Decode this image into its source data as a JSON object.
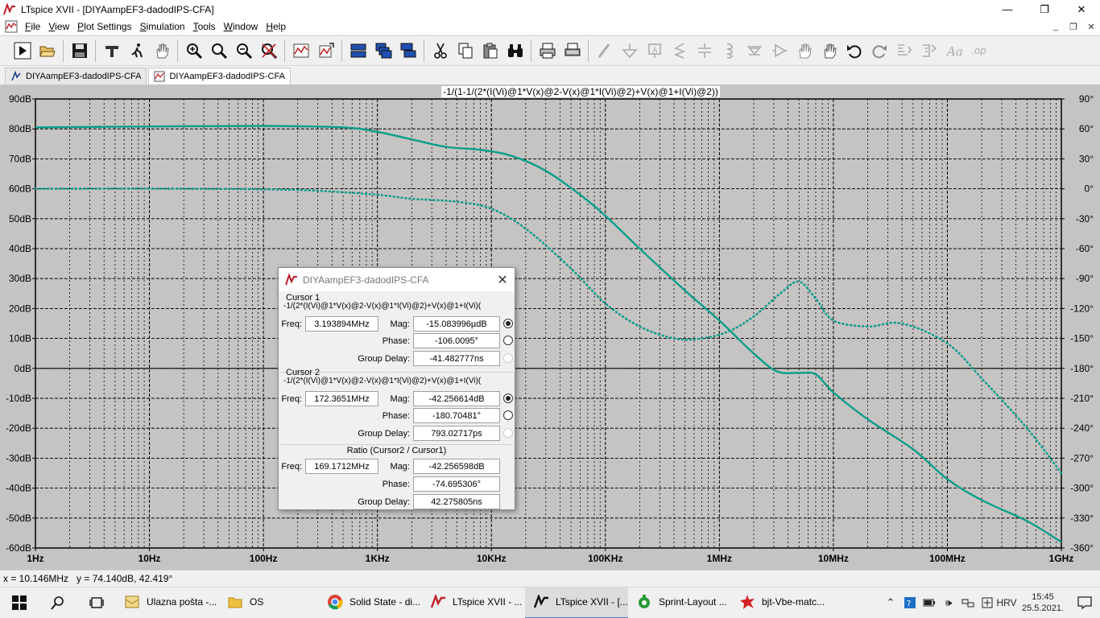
{
  "window": {
    "title": "LTspice XVII - [DIYAampEF3-dadodIPS-CFA]",
    "min_label": "—",
    "max_label": "❐",
    "close_label": "✕"
  },
  "menu": {
    "items": [
      "File",
      "View",
      "Plot Settings",
      "Simulation",
      "Tools",
      "Window",
      "Help"
    ],
    "mdi_min": "_",
    "mdi_restore": "❐",
    "mdi_close": "✕"
  },
  "toolbar": {
    "icons": [
      "run-icon",
      "open-icon",
      "save-icon",
      "control-panel-icon",
      "halt-icon",
      "pan-icon",
      "zoom-in-icon",
      "zoom-rect-icon",
      "zoom-out-icon",
      "zoom-cancel-icon",
      "autorange-icon",
      "fit-icon",
      "tile-horizontal-icon",
      "cascade-icon",
      "tile-vertical-icon",
      "cut-icon",
      "copy-icon",
      "paste-icon",
      "find-icon",
      "print-icon",
      "print-setup-icon",
      "wire-icon",
      "ground-icon",
      "label-icon",
      "resistor-icon",
      "capacitor-icon",
      "inductor-icon",
      "diode-icon",
      "component-icon",
      "move-icon",
      "drag-icon",
      "undo-icon",
      "redo-icon",
      "rotate-icon",
      "mirror-icon",
      "text-icon",
      "spice-directive-icon"
    ]
  },
  "tabs": [
    {
      "label": "DIYAampEF3-dadodIPS-CFA",
      "active": false,
      "icon": "schematic-icon"
    },
    {
      "label": "DIYAampEF3-dadodIPS-CFA",
      "active": true,
      "icon": "waveform-icon"
    }
  ],
  "plot": {
    "trace_expression": "-1/(1-1/(2*(I(Vi)@1*V(x)@2-V(x)@1*I(Vi)@2)+V(x)@1+I(Vi)@2))",
    "colors": {
      "background": "#c6c3c3",
      "grid": "#000000",
      "trace": "#0a9f8a",
      "axis_text": "#000000"
    }
  },
  "chart_data": {
    "type": "line",
    "title": "-1/(1-1/(2*(I(Vi)@1*V(x)@2-V(x)@1*I(Vi)@2)+V(x)@1+I(Vi)@2))",
    "xscale": "log",
    "xlim": [
      1,
      1000000000
    ],
    "xticks": [
      {
        "value": 1,
        "label": "1Hz"
      },
      {
        "value": 10,
        "label": "10Hz"
      },
      {
        "value": 100,
        "label": "100Hz"
      },
      {
        "value": 1000,
        "label": "1KHz"
      },
      {
        "value": 10000,
        "label": "10KHz"
      },
      {
        "value": 100000,
        "label": "100KHz"
      },
      {
        "value": 1000000,
        "label": "1MHz"
      },
      {
        "value": 10000000,
        "label": "10MHz"
      },
      {
        "value": 100000000,
        "label": "100MHz"
      },
      {
        "value": 1000000000,
        "label": "1GHz"
      }
    ],
    "ylim": [
      -60,
      90
    ],
    "yticks": [
      {
        "value": 90,
        "label": "90dB"
      },
      {
        "value": 80,
        "label": "80dB"
      },
      {
        "value": 70,
        "label": "70dB"
      },
      {
        "value": 60,
        "label": "60dB"
      },
      {
        "value": 50,
        "label": "50dB"
      },
      {
        "value": 40,
        "label": "40dB"
      },
      {
        "value": 30,
        "label": "30dB"
      },
      {
        "value": 20,
        "label": "20dB"
      },
      {
        "value": 10,
        "label": "10dB"
      },
      {
        "value": 0,
        "label": "0dB"
      },
      {
        "value": -10,
        "label": "-10dB"
      },
      {
        "value": -20,
        "label": "-20dB"
      },
      {
        "value": -30,
        "label": "-30dB"
      },
      {
        "value": -40,
        "label": "-40dB"
      },
      {
        "value": -50,
        "label": "-50dB"
      },
      {
        "value": -60,
        "label": "-60dB"
      }
    ],
    "y2lim": [
      -360,
      90
    ],
    "y2ticks": [
      {
        "value": 90,
        "label": "90°"
      },
      {
        "value": 60,
        "label": "60°"
      },
      {
        "value": 30,
        "label": "30°"
      },
      {
        "value": 0,
        "label": "0°"
      },
      {
        "value": -30,
        "label": "-30°"
      },
      {
        "value": -60,
        "label": "-60°"
      },
      {
        "value": -90,
        "label": "-90°"
      },
      {
        "value": -120,
        "label": "-120°"
      },
      {
        "value": -150,
        "label": "-150°"
      },
      {
        "value": -180,
        "label": "-180°"
      },
      {
        "value": -210,
        "label": "-210°"
      },
      {
        "value": -240,
        "label": "-240°"
      },
      {
        "value": -270,
        "label": "-270°"
      },
      {
        "value": -300,
        "label": "-300°"
      },
      {
        "value": -330,
        "label": "-330°"
      },
      {
        "value": -360,
        "label": "-360°"
      }
    ],
    "grid": true,
    "series": [
      {
        "axis": "left",
        "style": "solid",
        "points": [
          [
            1,
            80.5
          ],
          [
            10,
            80.8
          ],
          [
            100,
            81.0
          ],
          [
            500,
            80.5
          ],
          [
            1000,
            79.0
          ],
          [
            2000,
            76.5
          ],
          [
            4000,
            74.0
          ],
          [
            8000,
            73.0
          ],
          [
            15000,
            71.0
          ],
          [
            30000,
            66.0
          ],
          [
            60000,
            58.0
          ],
          [
            100000,
            51.0
          ],
          [
            200000,
            40.0
          ],
          [
            500000,
            26.0
          ],
          [
            1000000,
            16.0
          ],
          [
            2000000,
            5.0
          ],
          [
            3200000,
            -1.0
          ],
          [
            5000000,
            -1.5
          ],
          [
            7000000,
            -2.0
          ],
          [
            10000000,
            -8.0
          ],
          [
            20000000,
            -17.0
          ],
          [
            50000000,
            -27.0
          ],
          [
            100000000,
            -37.0
          ],
          [
            200000000,
            -44.0
          ],
          [
            500000000,
            -51.0
          ],
          [
            1000000000,
            -58.0
          ]
        ]
      },
      {
        "axis": "right",
        "style": "dotted",
        "points": [
          [
            1,
            0
          ],
          [
            10,
            0.2
          ],
          [
            100,
            -0.5
          ],
          [
            300,
            -2.0
          ],
          [
            1000,
            -6.0
          ],
          [
            2000,
            -10.0
          ],
          [
            5000,
            -13.0
          ],
          [
            10000,
            -20.0
          ],
          [
            20000,
            -40.0
          ],
          [
            50000,
            -80.0
          ],
          [
            100000,
            -115.0
          ],
          [
            200000,
            -138.0
          ],
          [
            400000,
            -150.0
          ],
          [
            700000,
            -150.0
          ],
          [
            1200000,
            -143.0
          ],
          [
            2000000,
            -128.0
          ],
          [
            3500000,
            -104.0
          ],
          [
            5000000,
            -93.0
          ],
          [
            7000000,
            -110.0
          ],
          [
            10000000,
            -132.0
          ],
          [
            20000000,
            -138.0
          ],
          [
            40000000,
            -135.0
          ],
          [
            100000000,
            -155.0
          ],
          [
            200000000,
            -190.0
          ],
          [
            500000000,
            -240.0
          ],
          [
            1000000000,
            -285.0
          ]
        ]
      }
    ]
  },
  "cursor_dialog": {
    "title": "DIYAampEF3-dadodIPS-CFA",
    "close_label": "✕",
    "cursor1": {
      "title": "Cursor 1",
      "expression": "-1/(2*(I(Vi)@1*V(x)@2-V(x)@1*I(Vi)@2)+V(x)@1+I(Vi)(",
      "freq_label": "Freq:",
      "freq": "3.193894MHz",
      "mag_label": "Mag:",
      "mag": "-15.083996µdB",
      "phase_label": "Phase:",
      "phase": "-106.0095°",
      "gd_label": "Group Delay:",
      "gd": "-41.482777ns"
    },
    "cursor2": {
      "title": "Cursor 2",
      "expression": "-1/(2*(I(Vi)@1*V(x)@2-V(x)@1*I(Vi)@2)+V(x)@1+I(Vi)(",
      "freq_label": "Freq:",
      "freq": "172.3651MHz",
      "mag_label": "Mag:",
      "mag": "-42.256614dB",
      "phase_label": "Phase:",
      "phase": "-180.70481°",
      "gd_label": "Group Delay:",
      "gd": "793.02717ps"
    },
    "ratio": {
      "title": "Ratio (Cursor2 / Cursor1)",
      "freq_label": "Freq:",
      "freq": "169.1712MHz",
      "mag_label": "Mag:",
      "mag": "-42.256598dB",
      "phase_label": "Phase:",
      "phase": "-74.695306°",
      "gd_label": "Group Delay:",
      "gd": "42.275805ns"
    }
  },
  "status": {
    "text": "x = 10.146MHz   y = 74.140dB, 42.419°"
  },
  "taskbar": {
    "apps": [
      {
        "label": "Ulazna pošta -...",
        "icon": "mail-icon",
        "active": false
      },
      {
        "label": "OS",
        "icon": "folder-icon",
        "active": false
      },
      {
        "label": "Solid State - di...",
        "icon": "chrome-icon",
        "active": false
      },
      {
        "label": "LTspice XVII - ...",
        "icon": "ltspice-icon",
        "active": false
      },
      {
        "label": "LTspice XVII - [...",
        "icon": "ltspice-icon",
        "active": true
      },
      {
        "label": "Sprint-Layout ...",
        "icon": "sprint-layout-icon",
        "active": false
      },
      {
        "label": "bjt-Vbe-matc...",
        "icon": "bjt-icon",
        "active": false
      }
    ],
    "language": "HRV",
    "time": "15:45",
    "date": "25.5.2021."
  }
}
